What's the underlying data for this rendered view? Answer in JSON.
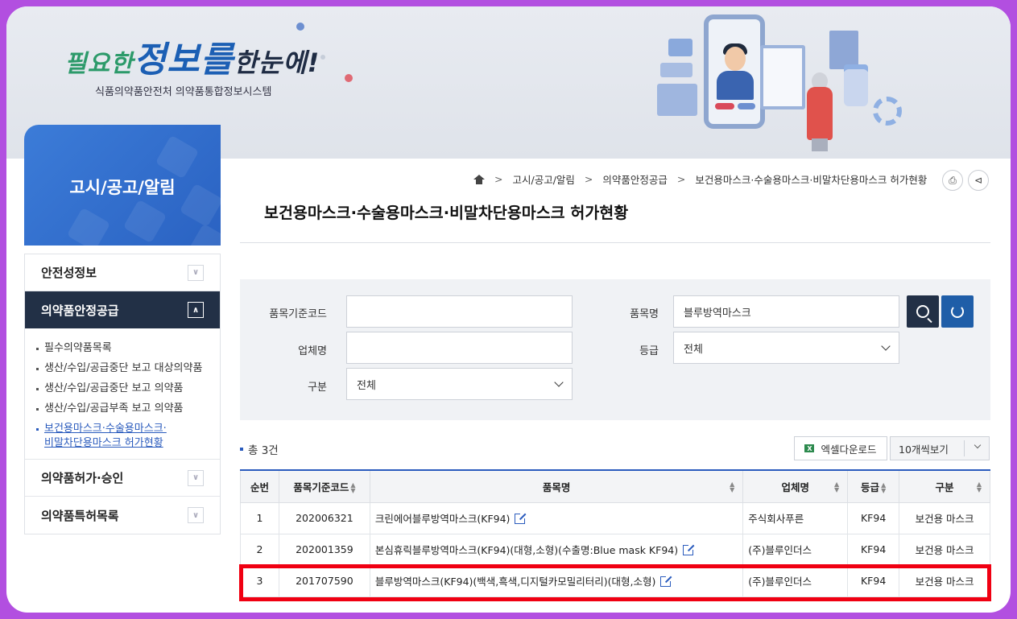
{
  "header": {
    "slogan_part1": "필요한",
    "slogan_part2": "정보를",
    "slogan_part3": "한눈에!",
    "system_name": "식품의약품안전처 의약품통합정보시스템"
  },
  "sidebar": {
    "section_title": "고시/공고/알림",
    "items": [
      {
        "label": "안전성정보",
        "toggle": "∨"
      },
      {
        "label": "의약품안정공급",
        "toggle": "∧"
      },
      {
        "label": "의약품허가·승인",
        "toggle": "∨"
      },
      {
        "label": "의약품특허목록",
        "toggle": "∨"
      }
    ],
    "sub_items": [
      "필수의약품목록",
      "생산/수입/공급중단 보고 대상의약품",
      "생산/수입/공급중단 보고 의약품",
      "생산/수입/공급부족 보고 의약품"
    ],
    "current_sub_line1": "보건용마스크·수술용마스크·",
    "current_sub_line2": "비말차단용마스크 허가현황"
  },
  "breadcrumb": {
    "items": [
      "고시/공고/알림",
      "의약품안정공급",
      "보건용마스크·수술용마스크·비말차단용마스크 허가현황"
    ],
    "separator": ">"
  },
  "page": {
    "title": "보건용마스크·수술용마스크·비말차단용마스크 허가현황"
  },
  "search": {
    "code_label": "품목기준코드",
    "code_value": "",
    "name_label": "품목명",
    "name_value": "블루방역마스크",
    "company_label": "업체명",
    "company_value": "",
    "grade_label": "등급",
    "grade_value": "전체",
    "type_label": "구분",
    "type_value": "전체"
  },
  "results": {
    "total_text": "총 3건",
    "excel_label": "엑셀다운로드",
    "page_size": "10개씩보기",
    "columns": [
      "순번",
      "품목기준코드",
      "품목명",
      "업체명",
      "등급",
      "구분"
    ],
    "rows": [
      {
        "no": "1",
        "code": "202006321",
        "name": "크린에어블루방역마스크(KF94)",
        "company": "주식회사푸른",
        "grade": "KF94",
        "type": "보건용 마스크"
      },
      {
        "no": "2",
        "code": "202001359",
        "name": "본심휴릭블루방역마스크(KF94)(대형,소형)(수출명:Blue mask KF94)",
        "company": "(주)블루인더스",
        "grade": "KF94",
        "type": "보건용 마스크"
      },
      {
        "no": "3",
        "code": "201707590",
        "name": "블루방역마스크(KF94)(백색,흑색,디지털카모밀리터리)(대형,소형)",
        "company": "(주)블루인더스",
        "grade": "KF94",
        "type": "보건용 마스크"
      }
    ]
  },
  "colors": {
    "accent": "#2a5bbd",
    "dark_navy": "#223046",
    "highlight_red": "#f00012",
    "frame_purple": "#b24fe0"
  }
}
